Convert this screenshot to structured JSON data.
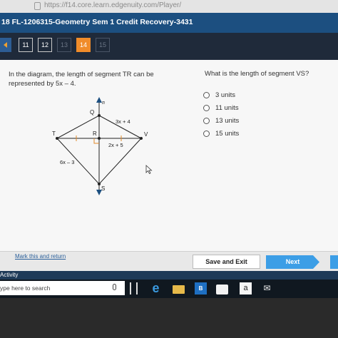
{
  "browser": {
    "url": "https://f14.core.learn.edgenuity.com/Player/"
  },
  "course": {
    "title": "18 FL-1206315-Geometry Sem 1 Credit Recovery-3431"
  },
  "nav": {
    "items": [
      {
        "label": "11",
        "state": "normal"
      },
      {
        "label": "12",
        "state": "normal"
      },
      {
        "label": "13",
        "state": "dim"
      },
      {
        "label": "14",
        "state": "active"
      },
      {
        "label": "15",
        "state": "dim"
      }
    ]
  },
  "question": {
    "prompt": "In the diagram, the length of segment TR can be represented by 5x – 4.",
    "ask": "What is the length of segment VS?",
    "options": [
      "3 units",
      "11 units",
      "13 units",
      "15 units"
    ]
  },
  "diagram": {
    "labels": {
      "n": "n",
      "Q": "Q",
      "T": "T",
      "R": "R",
      "V": "V",
      "S": "S",
      "qv": "3x + 4",
      "rv": "2x + 5",
      "ts": "6x – 3"
    }
  },
  "footer": {
    "mark_link": "Mark this and return",
    "save_exit": "Save and Exit",
    "next": "Next"
  },
  "activity": "Activity",
  "taskbar": {
    "search_placeholder": "ype here to search",
    "store_letter": "B",
    "amazon_letter": "a"
  },
  "colors": {
    "header": "#1c4f80",
    "nav_active": "#f08c2a",
    "next_button": "#3c9ee6"
  }
}
